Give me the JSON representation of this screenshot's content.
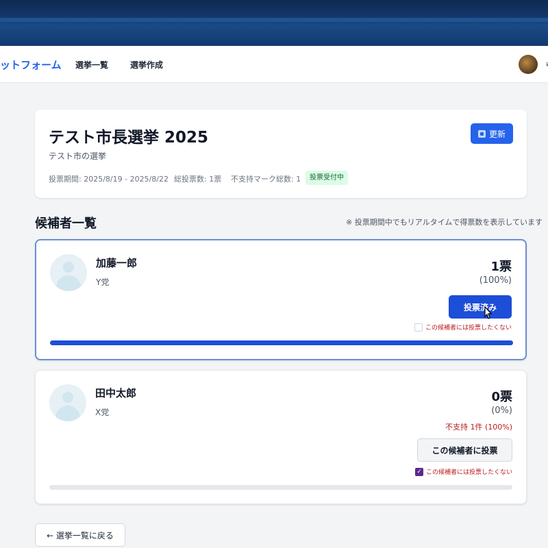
{
  "navbar": {
    "brand": "ットフォーム",
    "links": [
      "選挙一覧",
      "選挙作成"
    ],
    "user_label": "≠"
  },
  "election": {
    "title": "テスト市長選挙 2025",
    "description": "テスト市の選挙",
    "period": "投票期間: 2025/8/19 - 2025/8/22",
    "total_votes": "総投票数: 1票",
    "no_support_total": "不支持マーク総数: 1",
    "status": "投票受付中",
    "refresh_label": "更新"
  },
  "candidates_section": {
    "title": "候補者一覧",
    "note": "※ 投票期間中でもリアルタイムで得票数を表示しています"
  },
  "candidates": [
    {
      "name": "加藤一郎",
      "party": "Y党",
      "votes": "1票",
      "percent": "(100%)",
      "share": 1.0,
      "button_label": "投票済み",
      "no_vote_label": "この候補者には投票したくない",
      "no_vote_checked": false
    },
    {
      "name": "田中太郎",
      "party": "X党",
      "votes": "0票",
      "percent": "(0%)",
      "share": 0.0,
      "no_support": "不支持 1件 (100%)",
      "button_label": "この候補者に投票",
      "no_vote_label": "この候補者には投票したくない",
      "no_vote_checked": true
    }
  ],
  "back_label": "← 選挙一覧に戻る",
  "colors": {
    "primary": "#2563eb",
    "progress": "#1d4ed8",
    "status_bg": "#dcfce7",
    "warning_text": "#b91c1c"
  }
}
